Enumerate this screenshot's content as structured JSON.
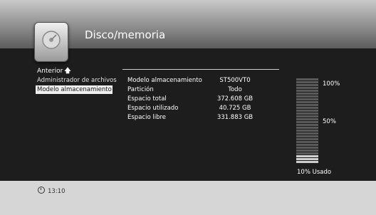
{
  "header": {
    "title": "Disco/memoria",
    "icon": "disk-icon"
  },
  "nav": {
    "back_label": "Anterior",
    "back_icon": "arrow-up-icon"
  },
  "menu": {
    "items": [
      {
        "label": "Administrador de archivos"
      },
      {
        "label": "Modelo almacenamiento"
      }
    ]
  },
  "info": {
    "rows": [
      {
        "label": "Modelo almacenamiento",
        "value": "ST500VT0"
      },
      {
        "label": "Partición",
        "value": "Todo"
      },
      {
        "label": "Espacio total",
        "value": "372.608 GB"
      },
      {
        "label": "Espacio utilizado",
        "value": "40.725 GB"
      },
      {
        "label": "Espacio libre",
        "value": "331.883 GB"
      }
    ]
  },
  "gauge": {
    "label_top": "100%",
    "label_mid": "50%",
    "usage_text": "10% Usado",
    "used_fraction": 0.1
  },
  "footer": {
    "time": "13:10",
    "clock_icon": "clock-icon"
  }
}
